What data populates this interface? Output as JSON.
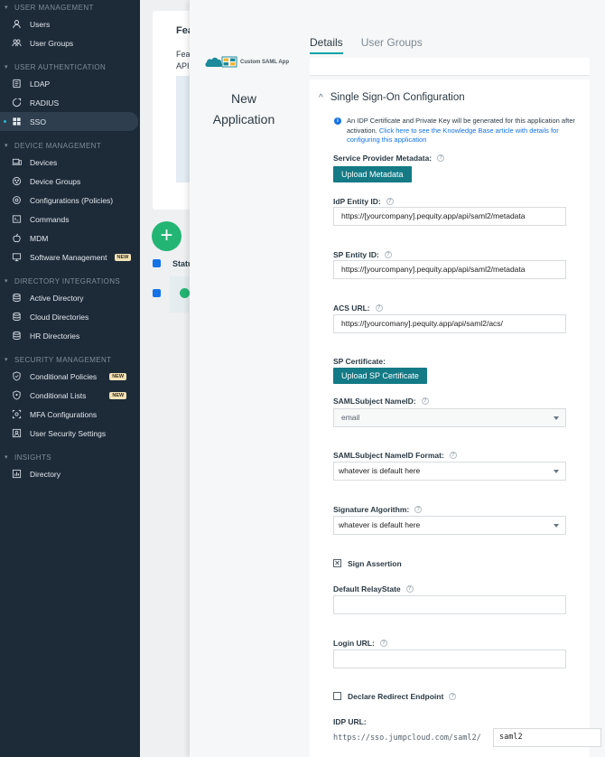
{
  "sidebar": {
    "sections": [
      {
        "title": "USER MANAGEMENT",
        "items": [
          {
            "label": "Users",
            "icon": "user-icon"
          },
          {
            "label": "User Groups",
            "icon": "user-groups-icon"
          }
        ]
      },
      {
        "title": "USER AUTHENTICATION",
        "items": [
          {
            "label": "LDAP",
            "icon": "ldap-icon"
          },
          {
            "label": "RADIUS",
            "icon": "radius-icon"
          },
          {
            "label": "SSO",
            "icon": "sso-icon",
            "active": true
          }
        ]
      },
      {
        "title": "DEVICE MANAGEMENT",
        "items": [
          {
            "label": "Devices",
            "icon": "devices-icon"
          },
          {
            "label": "Device Groups",
            "icon": "device-groups-icon"
          },
          {
            "label": "Configurations (Policies)",
            "icon": "configurations-icon"
          },
          {
            "label": "Commands",
            "icon": "commands-icon"
          },
          {
            "label": "MDM",
            "icon": "apple-icon"
          },
          {
            "label": "Software Management",
            "icon": "software-icon",
            "badge": "NEW"
          }
        ]
      },
      {
        "title": "DIRECTORY INTEGRATIONS",
        "items": [
          {
            "label": "Active Directory",
            "icon": "database-icon"
          },
          {
            "label": "Cloud Directories",
            "icon": "cloud-directories-icon"
          },
          {
            "label": "HR Directories",
            "icon": "hr-directories-icon"
          }
        ]
      },
      {
        "title": "SECURITY MANAGEMENT",
        "items": [
          {
            "label": "Conditional Policies",
            "icon": "shield-icon",
            "badge": "NEW"
          },
          {
            "label": "Conditional Lists",
            "icon": "shield-list-icon",
            "badge": "NEW"
          },
          {
            "label": "MFA Configurations",
            "icon": "mfa-icon"
          },
          {
            "label": "User Security Settings",
            "icon": "security-settings-icon"
          }
        ]
      },
      {
        "title": "INSIGHTS",
        "items": [
          {
            "label": "Directory",
            "icon": "chart-icon"
          }
        ]
      }
    ]
  },
  "background": {
    "card_title": "Fea",
    "card_sub1": "Fea",
    "card_sub2": "API",
    "add_label": "+",
    "status_header": "Statu"
  },
  "modal": {
    "logo_text": "Custom SAML App",
    "app_name_line1": "New",
    "app_name_line2": "Application",
    "tabs": [
      "Details",
      "User Groups"
    ],
    "section_title": "Single Sign-On Configuration",
    "info_text": "An IDP Certificate and Private Key will be generated for this application after activation. ",
    "info_link": "Click here to see the Knowledge Base article with details for configuring this application",
    "sp_metadata_label": "Service Provider Metadata:",
    "upload_metadata": "Upload Metadata",
    "idp_entity_label": "IdP Entity ID:",
    "idp_entity_value": "https://[yourcompany].pequity.app/api/saml2/metadata",
    "sp_entity_label": "SP Entity ID:",
    "sp_entity_value": "https://[yourcompany].pequity.app/api/saml2/metadata",
    "acs_label": "ACS URL:",
    "acs_value": "https://[yourcomany].pequity.app/api/saml2/acs/",
    "sp_cert_label": "SP Certificate:",
    "upload_sp_cert": "Upload SP Certificate",
    "nameid_label": "SAMLSubject NameID:",
    "nameid_value": "email",
    "nameid_format_label": "SAMLSubject NameID Format:",
    "nameid_format_value": "whatever is default here",
    "sig_alg_label": "Signature Algorithm:",
    "sig_alg_value": "whatever is default here",
    "sign_assertion_label": "Sign Assertion",
    "sign_assertion_mark": "✕",
    "relay_label": "Default RelayState",
    "relay_value": "",
    "login_label": "Login URL:",
    "login_value": "",
    "redirect_label": "Declare Redirect Endpoint",
    "idp_url_label": "IDP URL:",
    "idp_url_prefix": "https://sso.jumpcloud.com/saml2/",
    "idp_url_value": "saml2",
    "help_glyph": "?"
  },
  "colors": {
    "sidebar_bg": "#1d2b39",
    "accent_teal": "#137a86",
    "tab_underline": "#10a4a9",
    "link_blue": "#1473e6",
    "add_green": "#22b573"
  }
}
